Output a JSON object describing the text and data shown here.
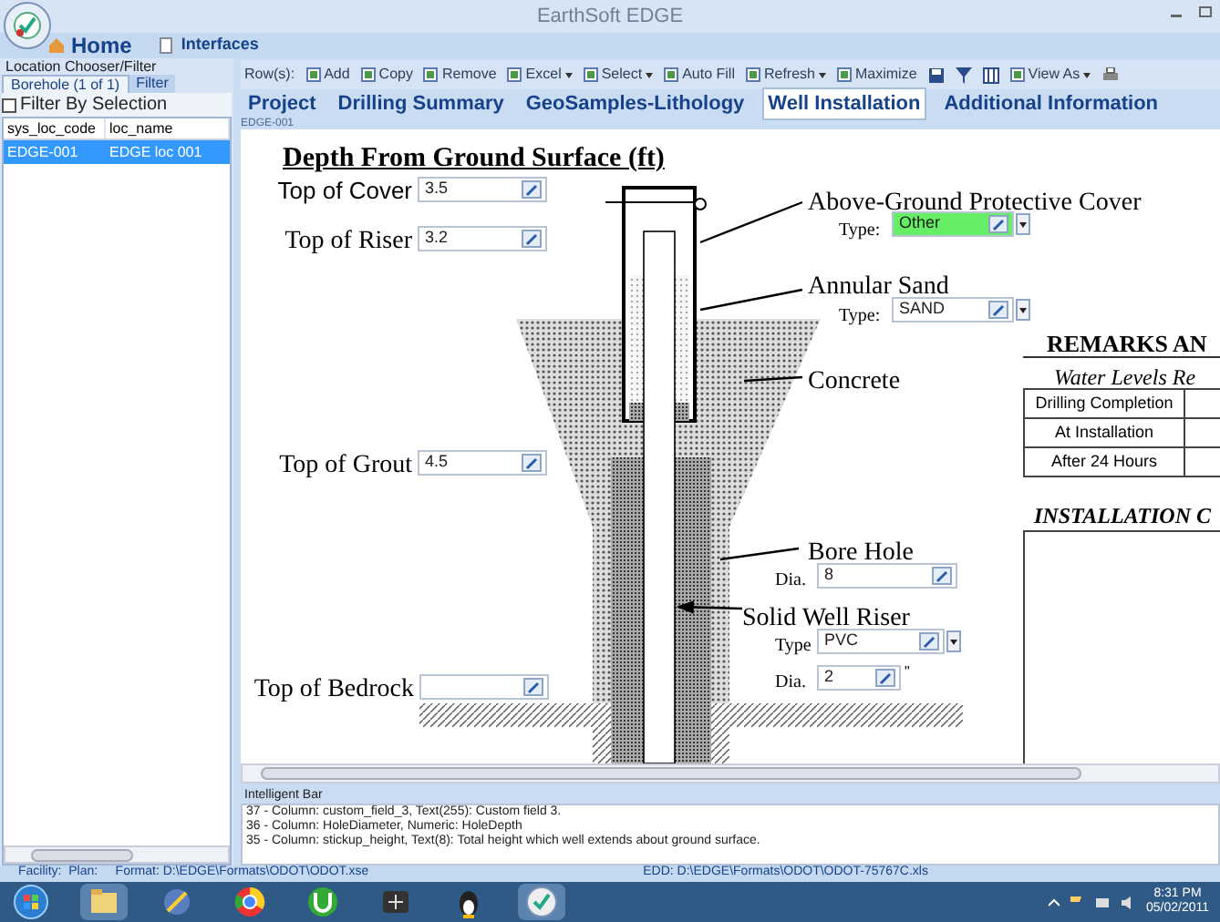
{
  "window": {
    "title": "EarthSoft EDGE"
  },
  "ribbon": [
    {
      "label": "Home",
      "selected": true
    },
    {
      "label": "Interfaces",
      "selected": false
    }
  ],
  "left_panel": {
    "title": "Location Chooser/Filter",
    "tabs": [
      {
        "label": "Borehole (1 of 1)",
        "selected": true
      },
      {
        "label": "Filter",
        "selected": false
      }
    ],
    "filter_by_selection": {
      "label": "Filter By Selection",
      "checked": false
    },
    "columns": [
      "sys_loc_code",
      "loc_name"
    ],
    "rows": [
      {
        "cells": [
          "EDGE-001",
          "EDGE loc 001"
        ],
        "selected": true
      }
    ]
  },
  "toolbar": [
    {
      "label": "Row(s):",
      "kind": "label"
    },
    {
      "label": "Add",
      "kind": "button"
    },
    {
      "label": "Copy",
      "kind": "button"
    },
    {
      "label": "Remove",
      "kind": "button"
    },
    {
      "label": "Excel",
      "kind": "menu"
    },
    {
      "label": "Select",
      "kind": "menu"
    },
    {
      "label": "Auto Fill",
      "kind": "button"
    },
    {
      "label": "Refresh",
      "kind": "menu"
    },
    {
      "label": "Maximize",
      "kind": "button"
    },
    {
      "label": "View As",
      "kind": "menu"
    }
  ],
  "tabs": [
    {
      "label": "Project",
      "selected": false
    },
    {
      "label": "Drilling Summary",
      "selected": false
    },
    {
      "label": "GeoSamples-Lithology",
      "selected": false
    },
    {
      "label": "Well Installation",
      "selected": true
    },
    {
      "label": "Additional Information",
      "selected": false
    }
  ],
  "record": "EDGE-001",
  "diagram": {
    "title": "Depth From Ground Surface (ft)",
    "depth_fields": [
      {
        "label": "Top of Cover",
        "value": "3.5"
      },
      {
        "label": "Top of Riser",
        "value": "3.2"
      },
      {
        "label": "Top of Grout",
        "value": "4.5"
      },
      {
        "label": "Top of Bedrock"
      }
    ],
    "cover": {
      "label": "Above-Ground Protective Cover",
      "type_label": "Type:",
      "type": "Other",
      "highlighted": true
    },
    "sand": {
      "label": "Annular Sand",
      "type_label": "Type:",
      "type": "SAND",
      "highlighted": false
    },
    "concrete": {
      "label": "Concrete"
    },
    "bore_hole": {
      "label": "Bore Hole",
      "dia_label": "Dia.",
      "dia": "8"
    },
    "riser": {
      "label": "Solid Well Riser",
      "type_label": "Type",
      "type": "PVC",
      "dia_label": "Dia.",
      "dia": "2",
      "unit": "\""
    }
  },
  "remarks": {
    "title": "REMARKS AN",
    "subtitle": "Water Levels Re",
    "rows": [
      "Drilling Completion",
      "At Installation",
      "After 24 Hours"
    ],
    "installation_title": "INSTALLATION C"
  },
  "intelligent_bar": {
    "title": "Intelligent Bar",
    "lines": [
      "37 - Column: custom_field_3, Text(255): Custom field 3.",
      "36 - Column: HoleDiameter, Numeric: HoleDepth",
      "35 - Column: stickup_height, Text(8): Total height which well extends about ground surface."
    ]
  },
  "status_bar": {
    "left": "Facility:  Plan:     Format: D:\\EDGE\\Formats\\ODOT\\ODOT.xse",
    "right": "EDD: D:\\EDGE\\Formats\\ODOT\\ODOT-75767C.xls"
  },
  "taskbar": {
    "time": "8:31 PM",
    "date": "05/02/2011"
  }
}
